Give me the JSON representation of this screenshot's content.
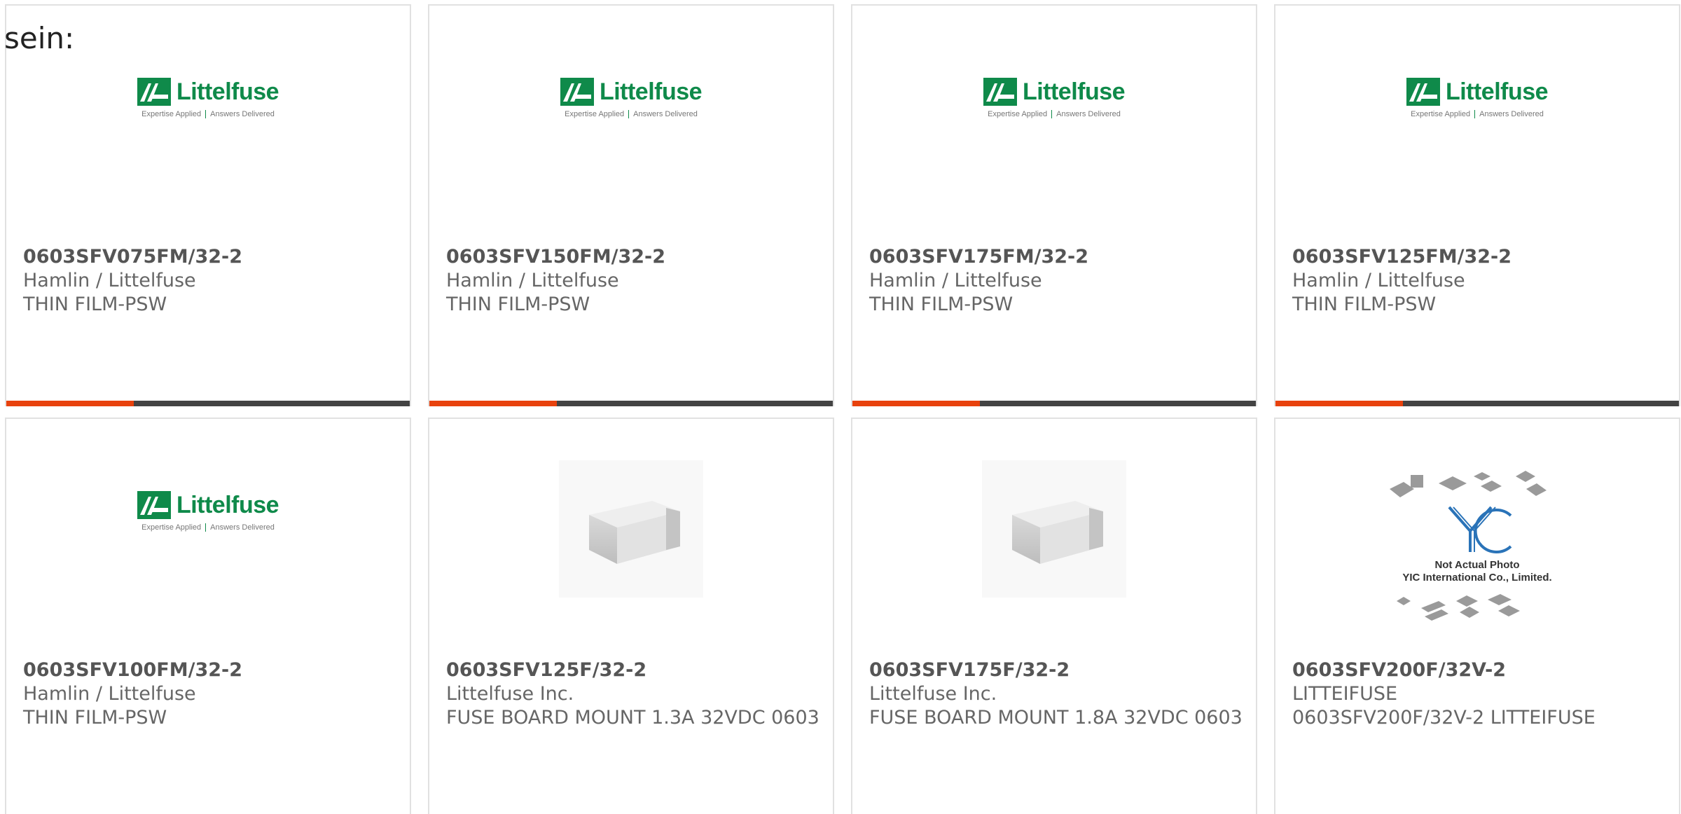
{
  "page": {
    "prefix_text": "sein:"
  },
  "theme": {
    "accent_color": "#e8420d",
    "bar_color": "#434343",
    "brand_green": "#0f8a4a"
  },
  "logo": {
    "word": "Littelfuse",
    "tagline_left": "Expertise Applied",
    "tagline_right": "Answers Delivered"
  },
  "placeholder": {
    "line1": "Not Actual Photo",
    "line2": "YIC International Co., Limited.",
    "logo_text": "YIC"
  },
  "products": [
    {
      "part_number": "0603SFV075FM/32-2",
      "manufacturer": "Hamlin / Littelfuse",
      "description": "THIN FILM-PSW",
      "image": "littelfuse-logo"
    },
    {
      "part_number": "0603SFV150FM/32-2",
      "manufacturer": "Hamlin / Littelfuse",
      "description": "THIN FILM-PSW",
      "image": "littelfuse-logo"
    },
    {
      "part_number": "0603SFV175FM/32-2",
      "manufacturer": "Hamlin / Littelfuse",
      "description": "THIN FILM-PSW",
      "image": "littelfuse-logo"
    },
    {
      "part_number": "0603SFV125FM/32-2",
      "manufacturer": "Hamlin / Littelfuse",
      "description": "THIN FILM-PSW",
      "image": "littelfuse-logo"
    },
    {
      "part_number": "0603SFV100FM/32-2",
      "manufacturer": "Hamlin / Littelfuse",
      "description": "THIN FILM-PSW",
      "image": "littelfuse-logo"
    },
    {
      "part_number": "0603SFV125F/32-2",
      "manufacturer": "Littelfuse Inc.",
      "description": "FUSE BOARD MOUNT 1.3A 32VDC 0603",
      "image": "chip-photo"
    },
    {
      "part_number": "0603SFV175F/32-2",
      "manufacturer": "Littelfuse Inc.",
      "description": "FUSE BOARD MOUNT 1.8A 32VDC 0603",
      "image": "chip-photo"
    },
    {
      "part_number": "0603SFV200F/32V-2",
      "manufacturer": "LITTEIFUSE",
      "description": "0603SFV200F/32V-2 LITTEIFUSE",
      "image": "yic-placeholder"
    }
  ]
}
